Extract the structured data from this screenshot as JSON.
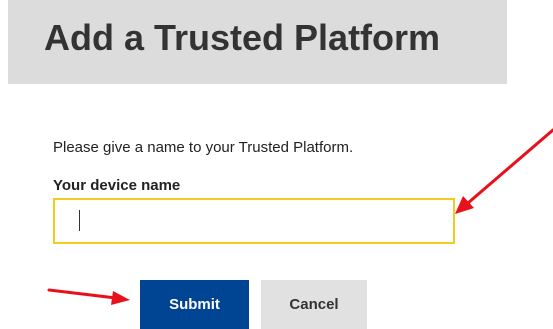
{
  "header": {
    "title": "Add a Trusted Platform"
  },
  "form": {
    "instructions": "Please give a name to your Trusted Platform.",
    "device_name_label": "Your device name",
    "device_name_value": ""
  },
  "buttons": {
    "submit_label": "Submit",
    "cancel_label": "Cancel"
  },
  "colors": {
    "header_background": "#dcdcdc",
    "input_focus_border": "#f2cd1f",
    "submit_background": "#004494",
    "cancel_background": "#e1e1e1",
    "annotation_arrow": "#e8101a"
  },
  "annotations": {
    "arrows": [
      {
        "points_to": "device-name-input"
      },
      {
        "points_to": "submit-button"
      }
    ]
  }
}
